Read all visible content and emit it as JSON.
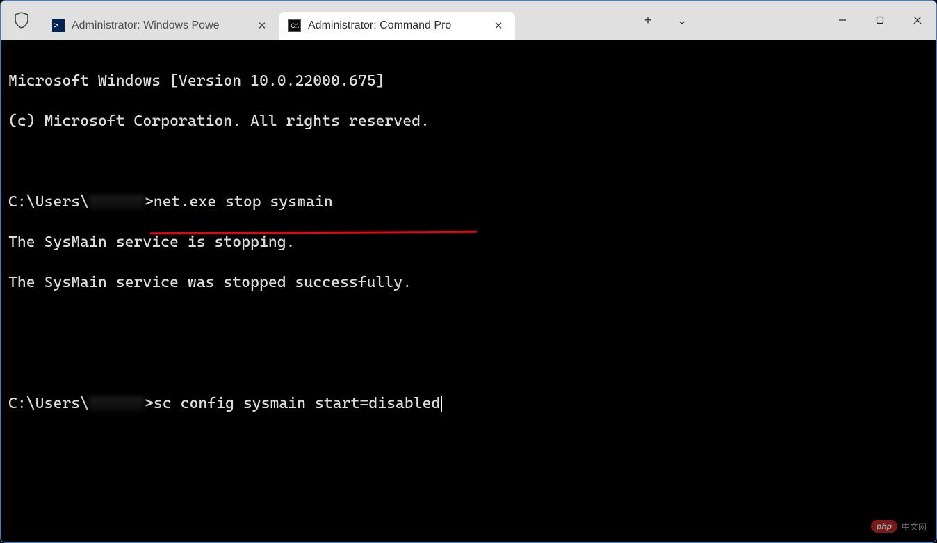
{
  "titlebar": {
    "tabs": [
      {
        "icon": "powershell-icon",
        "title": "Administrator: Windows Powe",
        "active": false
      },
      {
        "icon": "cmd-icon",
        "title": "Administrator: Command Pro",
        "active": true
      }
    ],
    "add_tab_glyph": "+",
    "dropdown_glyph": "⌄"
  },
  "terminal": {
    "version_line": "Microsoft Windows [Version 10.0.22000.675]",
    "copyright_line": "(c) Microsoft Corporation. All rights reserved.",
    "prompt_prefix": "C:\\Users\\",
    "prompt_suffix": ">",
    "command1": "net.exe stop sysmain",
    "output1_line1": "The SysMain service is stopping.",
    "output1_line2": "The SysMain service was stopped successfully.",
    "command2": "sc config sysmain start=disabled"
  },
  "watermark": {
    "pill": "php",
    "text": "中文网"
  }
}
